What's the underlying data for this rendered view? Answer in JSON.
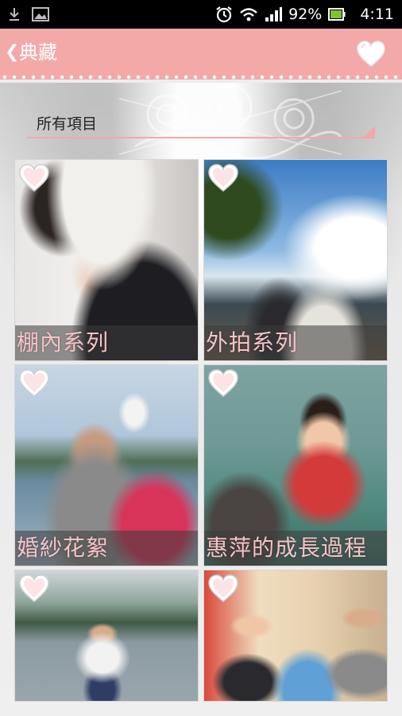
{
  "status_bar": {
    "battery": "92%",
    "time": "4:11",
    "icons": [
      "download-icon",
      "image-icon",
      "alarm-icon",
      "wifi-icon",
      "signal-icon",
      "battery-icon"
    ]
  },
  "app_bar": {
    "back_glyph": "❮",
    "title": "典藏",
    "favorite_icon": "heart-icon"
  },
  "filter": {
    "selected": "所有項目"
  },
  "albums": [
    {
      "caption": "棚內系列",
      "icon": "heart-icon"
    },
    {
      "caption": "外拍系列",
      "icon": "heart-icon"
    },
    {
      "caption": "婚紗花絮",
      "icon": "heart-icon"
    },
    {
      "caption": "惠萍的成長過程",
      "icon": "heart-icon"
    },
    {
      "caption": "",
      "icon": "heart-icon"
    },
    {
      "caption": "",
      "icon": "heart-icon"
    }
  ],
  "colors": {
    "accent": "#f3a9a8",
    "caption_text": "#f7c3c6",
    "status_bar": "#000000",
    "battery_green": "#7cc431"
  }
}
